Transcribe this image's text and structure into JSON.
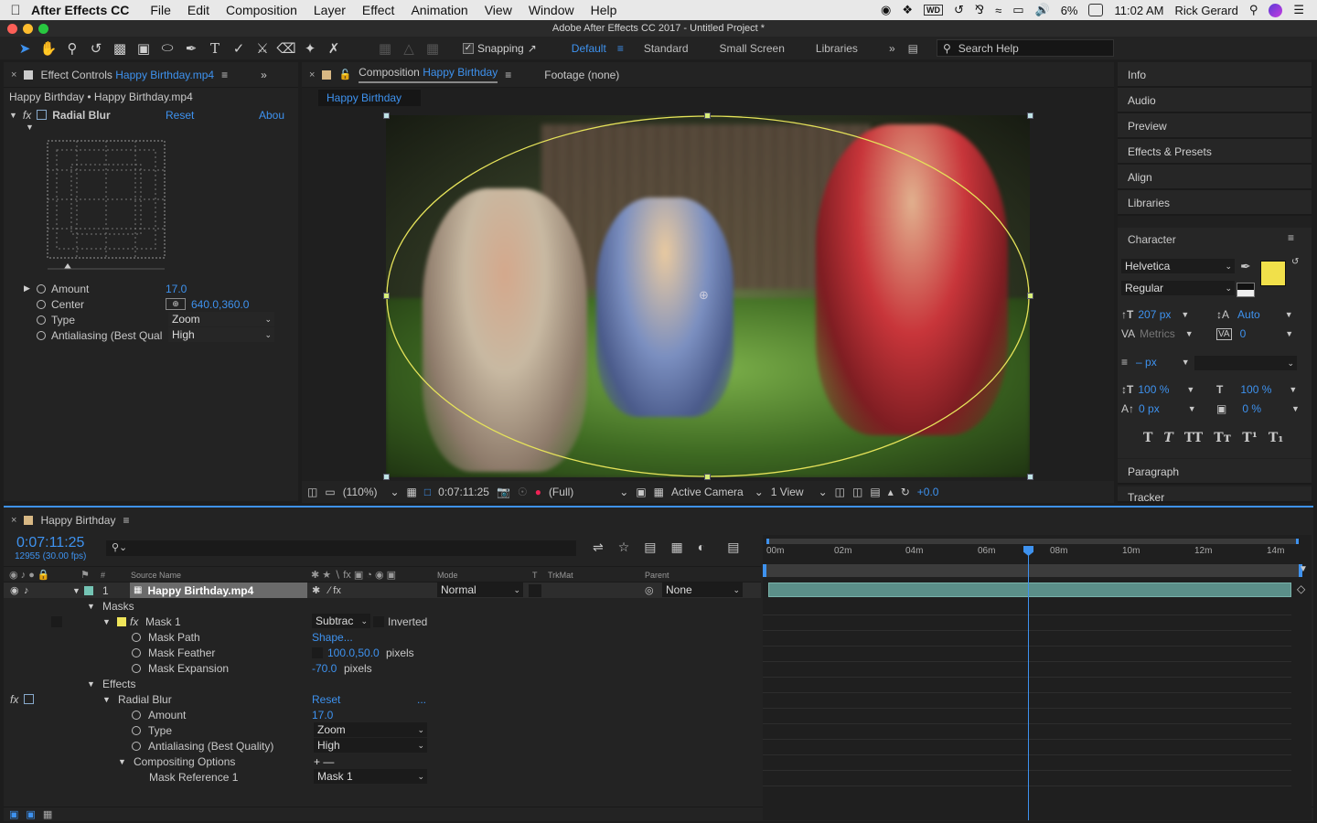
{
  "menubar": {
    "app_name": "After Effects CC",
    "items": [
      "File",
      "Edit",
      "Composition",
      "Layer",
      "Effect",
      "Animation",
      "View",
      "Window",
      "Help"
    ],
    "battery": "6%",
    "time": "11:02 AM",
    "user": "Rick Gerard"
  },
  "window": {
    "title": "Adobe After Effects CC 2017 - Untitled Project *"
  },
  "toolbar": {
    "snapping_label": "Snapping",
    "workspaces": [
      "Default",
      "Standard",
      "Small Screen",
      "Libraries"
    ],
    "active_workspace": "Default",
    "search_placeholder": "Search Help"
  },
  "effect_controls": {
    "tab_prefix": "Effect Controls",
    "tab_file": "Happy Birthday.mp4",
    "breadcrumb": "Happy Birthday • Happy Birthday.mp4",
    "effect_name": "Radial Blur",
    "reset_label": "Reset",
    "about_label": "Abou",
    "props": {
      "amount_label": "Amount",
      "amount_value": "17.0",
      "center_label": "Center",
      "center_value": "640.0,360.0",
      "type_label": "Type",
      "type_value": "Zoom",
      "aa_label": "Antialiasing (Best Qual",
      "aa_value": "High"
    }
  },
  "composition": {
    "tab_prefix": "Composition",
    "tab_name": "Happy Birthday",
    "footage_tab": "Footage (none)",
    "subtab": "Happy Birthday",
    "footer": {
      "zoom": "(110%)",
      "timecode": "0:07:11:25",
      "resolution": "(Full)",
      "camera": "Active Camera",
      "views": "1 View",
      "exposure": "+0.0"
    }
  },
  "right_panels": {
    "items": [
      "Info",
      "Audio",
      "Preview",
      "Effects & Presets",
      "Align",
      "Libraries"
    ],
    "character": {
      "title": "Character",
      "font": "Helvetica",
      "style": "Regular",
      "size": "207 px",
      "leading": "Auto",
      "kerning": "Metrics",
      "tracking": "0",
      "stroke": "– px",
      "vscale": "100 %",
      "hscale": "100 %",
      "baseline": "0 px",
      "tsume": "0 %",
      "fill_color": "#f1e04a"
    },
    "bottom_items": [
      "Paragraph",
      "Tracker"
    ]
  },
  "timeline": {
    "tab_name": "Happy Birthday",
    "timecode": "0:07:11:25",
    "frame_info": "12955 (30.00 fps)",
    "col_headers": {
      "num": "#",
      "source": "Source Name",
      "mode": "Mode",
      "t": "T",
      "trkmat": "TrkMat",
      "parent": "Parent"
    },
    "ruler": [
      "00m",
      "02m",
      "04m",
      "06m",
      "08m",
      "10m",
      "12m",
      "14m"
    ],
    "layer": {
      "num": "1",
      "name": "Happy Birthday.mp4",
      "mode": "Normal",
      "parent": "None"
    },
    "rows": {
      "masks": "Masks",
      "mask1": "Mask 1",
      "mask_mode": "Subtrac",
      "inverted": "Inverted",
      "mask_path": "Mask Path",
      "mask_path_val": "Shape...",
      "mask_feather": "Mask Feather",
      "mask_feather_val": "100.0,50.0",
      "mask_feather_unit": "pixels",
      "mask_expansion": "Mask Expansion",
      "mask_expansion_val": "-70.0",
      "mask_expansion_unit": "pixels",
      "effects": "Effects",
      "radial_blur": "Radial Blur",
      "reset": "Reset",
      "dots": "...",
      "amount": "Amount",
      "amount_val": "17.0",
      "type": "Type",
      "type_val": "Zoom",
      "aa": "Antialiasing (Best Quality)",
      "aa_val": "High",
      "comp_opts": "Compositing Options",
      "plusminus": "+ —",
      "mask_ref": "Mask Reference 1",
      "mask_ref_val": "Mask 1"
    }
  }
}
